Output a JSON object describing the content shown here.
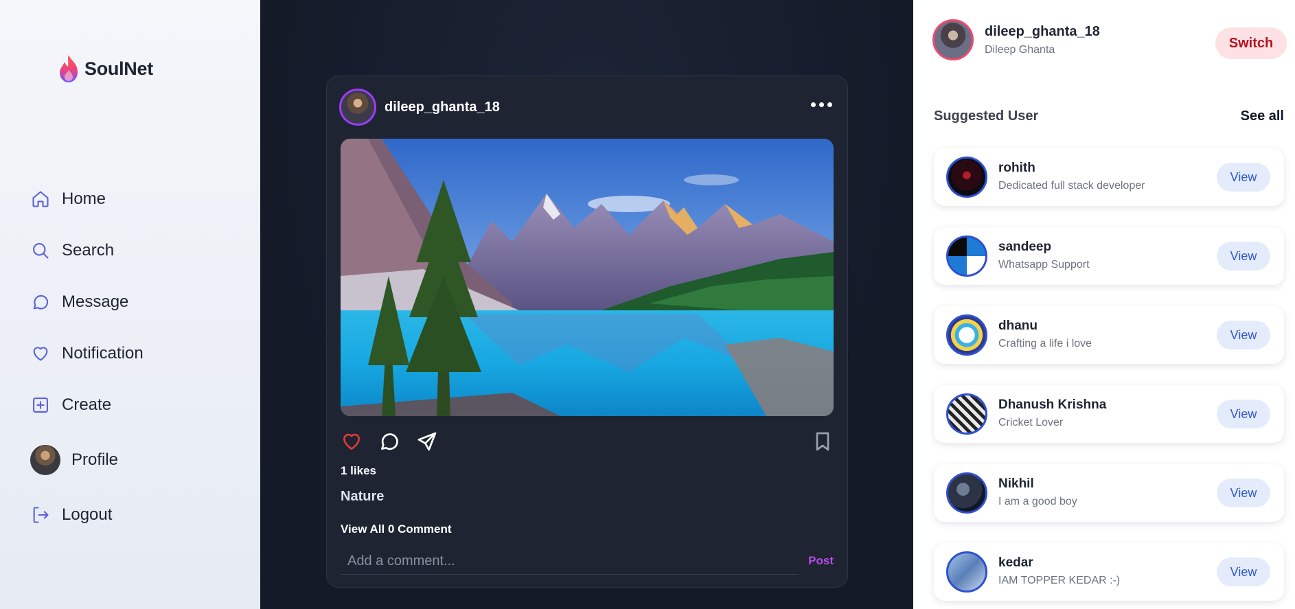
{
  "app": {
    "name": "SoulNet"
  },
  "sidebar": {
    "items": [
      {
        "label": "Home",
        "icon": "home-icon"
      },
      {
        "label": "Search",
        "icon": "search-icon"
      },
      {
        "label": "Message",
        "icon": "message-icon"
      },
      {
        "label": "Notification",
        "icon": "heart-icon"
      },
      {
        "label": "Create",
        "icon": "plus-square-icon"
      },
      {
        "label": "Profile",
        "icon": "avatar"
      },
      {
        "label": "Logout",
        "icon": "logout-icon"
      }
    ]
  },
  "post": {
    "username": "dileep_ghanta_18",
    "likes": "1 likes",
    "caption": "Nature",
    "view_comments": "View All 0 Comment",
    "comment_placeholder": "Add a comment...",
    "post_label": "Post",
    "liked": true
  },
  "current_user": {
    "username": "dileep_ghanta_18",
    "name": "Dileep Ghanta",
    "switch_label": "Switch"
  },
  "suggested": {
    "title": "Suggested User",
    "see_all": "See all",
    "view_label": "View",
    "users": [
      {
        "name": "rohith",
        "bio": "Dedicated full stack developer"
      },
      {
        "name": "sandeep",
        "bio": "Whatsapp Support"
      },
      {
        "name": "dhanu",
        "bio": "Crafting a life i love"
      },
      {
        "name": "Dhanush Krishna",
        "bio": "Cricket Lover"
      },
      {
        "name": "Nikhil",
        "bio": "I am a good boy"
      },
      {
        "name": "kedar",
        "bio": "IAM TOPPER KEDAR :-)"
      }
    ]
  },
  "colors": {
    "accent": "#5b62d9",
    "like": "#e53935",
    "post_button": "#b34be8",
    "switch_text": "#b4141e"
  }
}
